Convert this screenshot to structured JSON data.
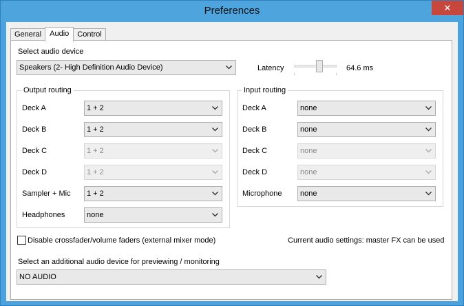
{
  "window": {
    "title": "Preferences",
    "close_glyph": "✕"
  },
  "tabs": [
    {
      "label": "General",
      "active": false
    },
    {
      "label": "Audio",
      "active": true
    },
    {
      "label": "Control",
      "active": false
    }
  ],
  "audio_device": {
    "label": "Select audio device",
    "value": "Speakers (2- High Definition Audio Device)"
  },
  "latency": {
    "label": "Latency",
    "value_text": "64.6 ms",
    "slider_fraction": 0.62
  },
  "output_routing": {
    "title": "Output routing",
    "rows": [
      {
        "label": "Deck A",
        "value": "1 + 2",
        "enabled": true
      },
      {
        "label": "Deck B",
        "value": "1 + 2",
        "enabled": true
      },
      {
        "label": "Deck C",
        "value": "1 + 2",
        "enabled": false
      },
      {
        "label": "Deck D",
        "value": "1 + 2",
        "enabled": false
      },
      {
        "label": "Sampler + Mic",
        "value": "1 + 2",
        "enabled": true
      },
      {
        "label": "Headphones",
        "value": "none",
        "enabled": true
      }
    ]
  },
  "input_routing": {
    "title": "Input routing",
    "rows": [
      {
        "label": "Deck A",
        "value": "none",
        "enabled": true
      },
      {
        "label": "Deck B",
        "value": "none",
        "enabled": true
      },
      {
        "label": "Deck C",
        "value": "none",
        "enabled": false
      },
      {
        "label": "Deck D",
        "value": "none",
        "enabled": false
      },
      {
        "label": "Microphone",
        "value": "none",
        "enabled": true
      }
    ]
  },
  "disable_faders": {
    "label": "Disable crossfader/volume faders (external mixer mode)",
    "checked": false
  },
  "current_settings": "Current audio settings: master FX can be used",
  "preview_device": {
    "label": "Select an additional audio device for previewing / monitoring",
    "value": "NO AUDIO"
  }
}
